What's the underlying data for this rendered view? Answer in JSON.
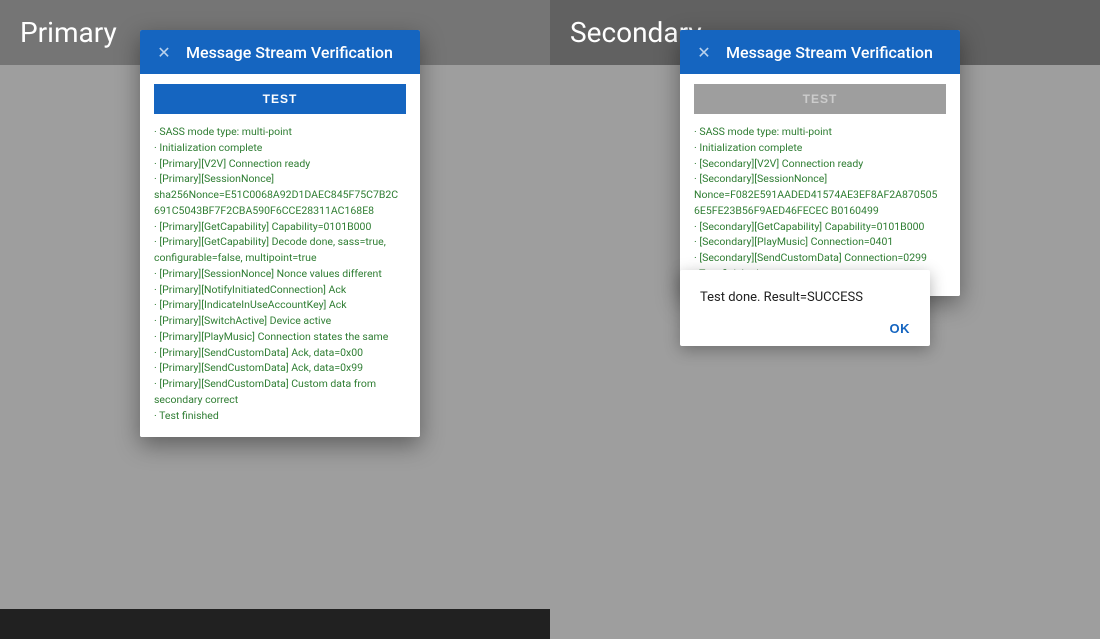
{
  "left": {
    "title": "Primary",
    "dialog": {
      "close_label": "✕",
      "title": "Message Stream Verification",
      "test_button": "TEST",
      "log_lines": [
        "· SASS mode type: multi-point",
        "· Initialization complete",
        "· [Primary][V2V] Connection ready",
        "· [Primary][SessionNonce] sha256Nonce=E51C0068A92D1DAEC845F75C7B2C691C5043BF7F2CBA590F6CCE28311AC168E8",
        "· [Primary][GetCapability] Capability=0101B000",
        "· [Primary][GetCapability] Decode done, sass=true, configurable=false, multipoint=true",
        "· [Primary][SessionNonce] Nonce values different",
        "· [Primary][NotifyInitiatedConnection] Ack",
        "· [Primary][IndicateInUseAccountKey] Ack",
        "· [Primary][SwitchActive] Device active",
        "· [Primary][PlayMusic] Connection states the same",
        "· [Primary][SendCustomData] Ack, data=0x00",
        "· [Primary][SendCustomData] Ack, data=0x99",
        "· [Primary][SendCustomData] Custom data from secondary correct",
        "· Test finished"
      ]
    }
  },
  "right": {
    "title": "Secondary",
    "dialog": {
      "close_label": "✕",
      "title": "Message Stream Verification",
      "test_button": "TEST",
      "log_lines": [
        "· SASS mode type: multi-point",
        "· Initialization complete",
        "· [Secondary][V2V] Connection ready",
        "· [Secondary][SessionNonce] Nonce=F082E591AADED41574AE3EF8AF2A870505 6E5FE23B56F9AED46FECEC B0160499",
        "· [Secondary][GetCapability] Capability=0101B000",
        "· [Secondary][PlayMusic] Connection=0401",
        "· [Secondary][SendCustomData] Connection=0299",
        "· Test finished"
      ],
      "result_popup": {
        "text": "Test done. Result=SUCCESS",
        "ok_label": "OK"
      }
    }
  }
}
